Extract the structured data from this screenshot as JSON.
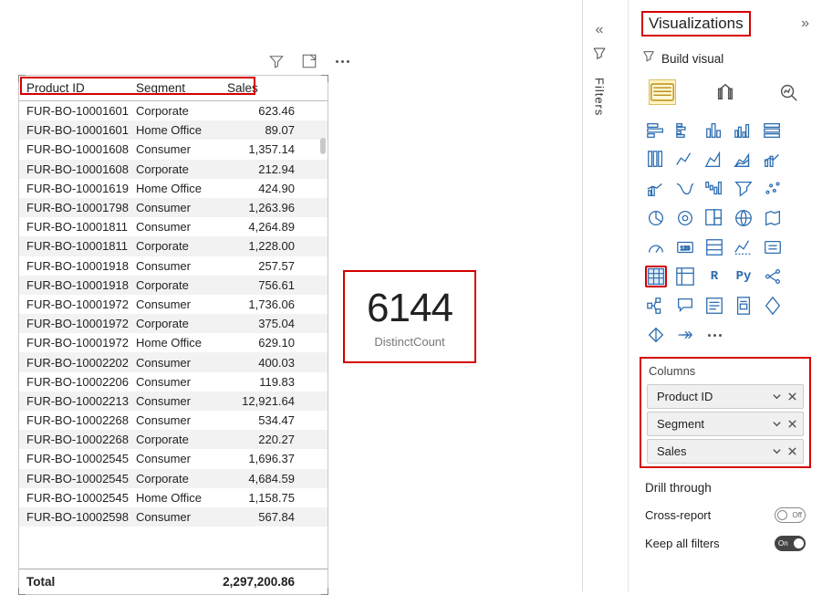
{
  "table": {
    "headers": {
      "product_id": "Product ID",
      "segment": "Segment",
      "sales": "Sales"
    },
    "rows": [
      {
        "pid": "FUR-BO-10001601",
        "seg": "Corporate",
        "sal": "623.46"
      },
      {
        "pid": "FUR-BO-10001601",
        "seg": "Home Office",
        "sal": "89.07"
      },
      {
        "pid": "FUR-BO-10001608",
        "seg": "Consumer",
        "sal": "1,357.14"
      },
      {
        "pid": "FUR-BO-10001608",
        "seg": "Corporate",
        "sal": "212.94"
      },
      {
        "pid": "FUR-BO-10001619",
        "seg": "Home Office",
        "sal": "424.90"
      },
      {
        "pid": "FUR-BO-10001798",
        "seg": "Consumer",
        "sal": "1,263.96"
      },
      {
        "pid": "FUR-BO-10001811",
        "seg": "Consumer",
        "sal": "4,264.89"
      },
      {
        "pid": "FUR-BO-10001811",
        "seg": "Corporate",
        "sal": "1,228.00"
      },
      {
        "pid": "FUR-BO-10001918",
        "seg": "Consumer",
        "sal": "257.57"
      },
      {
        "pid": "FUR-BO-10001918",
        "seg": "Corporate",
        "sal": "756.61"
      },
      {
        "pid": "FUR-BO-10001972",
        "seg": "Consumer",
        "sal": "1,736.06"
      },
      {
        "pid": "FUR-BO-10001972",
        "seg": "Corporate",
        "sal": "375.04"
      },
      {
        "pid": "FUR-BO-10001972",
        "seg": "Home Office",
        "sal": "629.10"
      },
      {
        "pid": "FUR-BO-10002202",
        "seg": "Consumer",
        "sal": "400.03"
      },
      {
        "pid": "FUR-BO-10002206",
        "seg": "Consumer",
        "sal": "119.83"
      },
      {
        "pid": "FUR-BO-10002213",
        "seg": "Consumer",
        "sal": "12,921.64"
      },
      {
        "pid": "FUR-BO-10002268",
        "seg": "Consumer",
        "sal": "534.47"
      },
      {
        "pid": "FUR-BO-10002268",
        "seg": "Corporate",
        "sal": "220.27"
      },
      {
        "pid": "FUR-BO-10002545",
        "seg": "Consumer",
        "sal": "1,696.37"
      },
      {
        "pid": "FUR-BO-10002545",
        "seg": "Corporate",
        "sal": "4,684.59"
      },
      {
        "pid": "FUR-BO-10002545",
        "seg": "Home Office",
        "sal": "1,158.75"
      },
      {
        "pid": "FUR-BO-10002598",
        "seg": "Consumer",
        "sal": "567.84"
      }
    ],
    "total_label": "Total",
    "total_value": "2,297,200.86"
  },
  "card": {
    "value": "6144",
    "label": "DistinctCount"
  },
  "filters_tab": {
    "label": "Filters"
  },
  "pane": {
    "title": "Visualizations",
    "build_label": "Build visual",
    "fields_section": "Columns",
    "fields": [
      {
        "label": "Product ID"
      },
      {
        "label": "Segment"
      },
      {
        "label": "Sales"
      }
    ],
    "drill": {
      "title": "Drill through",
      "cross_report": "Cross-report",
      "cross_report_state": "Off",
      "keep_all": "Keep all filters",
      "keep_all_state": "On"
    }
  }
}
